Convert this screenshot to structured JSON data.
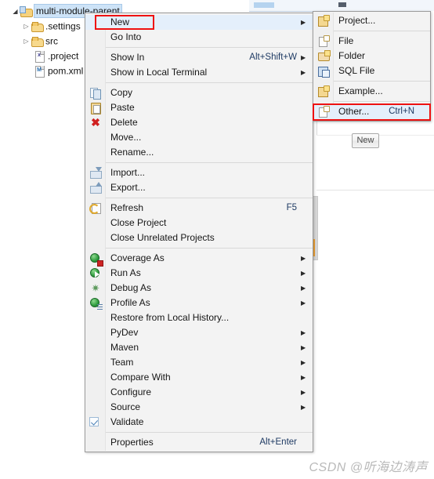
{
  "workbench": {
    "new_button_label": "New",
    "tab_indicator": ""
  },
  "tree": {
    "items": [
      {
        "label": "multi-module-parent",
        "icon": "project-icon",
        "expander": "expanded",
        "selected": true
      },
      {
        "label": ".settings",
        "icon": "folder-icon",
        "expander": "collapsed",
        "selected": false
      },
      {
        "label": "src",
        "icon": "folder-icon",
        "expander": "collapsed",
        "selected": false
      },
      {
        "label": ".project",
        "icon": "xml-file-icon",
        "glyph": "x",
        "expander": "none",
        "selected": false
      },
      {
        "label": "pom.xml",
        "icon": "maven-pom-icon",
        "glyph": "M",
        "expander": "none",
        "selected": false
      }
    ]
  },
  "context_menu": {
    "items": [
      {
        "label": "New",
        "accel": "",
        "submenu": true,
        "icon": "",
        "highlighted": true,
        "highlight_box": "red"
      },
      {
        "label": "Go Into",
        "accel": "",
        "submenu": false,
        "icon": ""
      },
      {
        "separator": true
      },
      {
        "label": "Show In",
        "accel": "Alt+Shift+W",
        "submenu": true,
        "icon": ""
      },
      {
        "label": "Show in Local Terminal",
        "accel": "",
        "submenu": true,
        "icon": ""
      },
      {
        "separator": true
      },
      {
        "label": "Copy",
        "accel": "",
        "submenu": false,
        "icon": "copy-icon"
      },
      {
        "label": "Paste",
        "accel": "",
        "submenu": false,
        "icon": "paste-icon"
      },
      {
        "label": "Delete",
        "accel": "",
        "submenu": false,
        "icon": "delete-icon"
      },
      {
        "label": "Move...",
        "accel": "",
        "submenu": false,
        "icon": ""
      },
      {
        "label": "Rename...",
        "accel": "",
        "submenu": false,
        "icon": ""
      },
      {
        "separator": true
      },
      {
        "label": "Import...",
        "accel": "",
        "submenu": false,
        "icon": "import-icon"
      },
      {
        "label": "Export...",
        "accel": "",
        "submenu": false,
        "icon": "export-icon"
      },
      {
        "separator": true
      },
      {
        "label": "Refresh",
        "accel": "F5",
        "submenu": false,
        "icon": "refresh-icon"
      },
      {
        "label": "Close Project",
        "accel": "",
        "submenu": false,
        "icon": ""
      },
      {
        "label": "Close Unrelated Projects",
        "accel": "",
        "submenu": false,
        "icon": ""
      },
      {
        "separator": true
      },
      {
        "label": "Coverage As",
        "accel": "",
        "submenu": true,
        "icon": "coverage-icon"
      },
      {
        "label": "Run As",
        "accel": "",
        "submenu": true,
        "icon": "run-icon"
      },
      {
        "label": "Debug As",
        "accel": "",
        "submenu": true,
        "icon": "debug-icon"
      },
      {
        "label": "Profile As",
        "accel": "",
        "submenu": true,
        "icon": "profile-icon"
      },
      {
        "label": "Restore from Local History...",
        "accel": "",
        "submenu": false,
        "icon": ""
      },
      {
        "label": "PyDev",
        "accel": "",
        "submenu": true,
        "icon": ""
      },
      {
        "label": "Maven",
        "accel": "",
        "submenu": true,
        "icon": ""
      },
      {
        "label": "Team",
        "accel": "",
        "submenu": true,
        "icon": ""
      },
      {
        "label": "Compare With",
        "accel": "",
        "submenu": true,
        "icon": ""
      },
      {
        "label": "Configure",
        "accel": "",
        "submenu": true,
        "icon": ""
      },
      {
        "label": "Source",
        "accel": "",
        "submenu": true,
        "icon": ""
      },
      {
        "label": "Validate",
        "accel": "",
        "submenu": false,
        "icon": "checkbox-checked-icon"
      },
      {
        "separator": true
      },
      {
        "label": "Properties",
        "accel": "Alt+Enter",
        "submenu": false,
        "icon": ""
      }
    ]
  },
  "submenu": {
    "items": [
      {
        "label": "Project...",
        "accel": "",
        "icon": "new-project-icon"
      },
      {
        "separator": true
      },
      {
        "label": "File",
        "accel": "",
        "icon": "new-file-icon"
      },
      {
        "label": "Folder",
        "accel": "",
        "icon": "new-folder-icon"
      },
      {
        "label": "SQL File",
        "accel": "",
        "icon": "sql-file-icon"
      },
      {
        "separator": true
      },
      {
        "label": "Example...",
        "accel": "",
        "icon": "new-example-icon"
      },
      {
        "separator": true
      },
      {
        "label": "Other...",
        "accel": "Ctrl+N",
        "icon": "new-other-icon",
        "highlighted": true,
        "highlight_box": "red"
      }
    ]
  },
  "annotations": {
    "highlight_color": "#ee1111"
  },
  "watermark": {
    "text": "CSDN @听海边涛声"
  }
}
